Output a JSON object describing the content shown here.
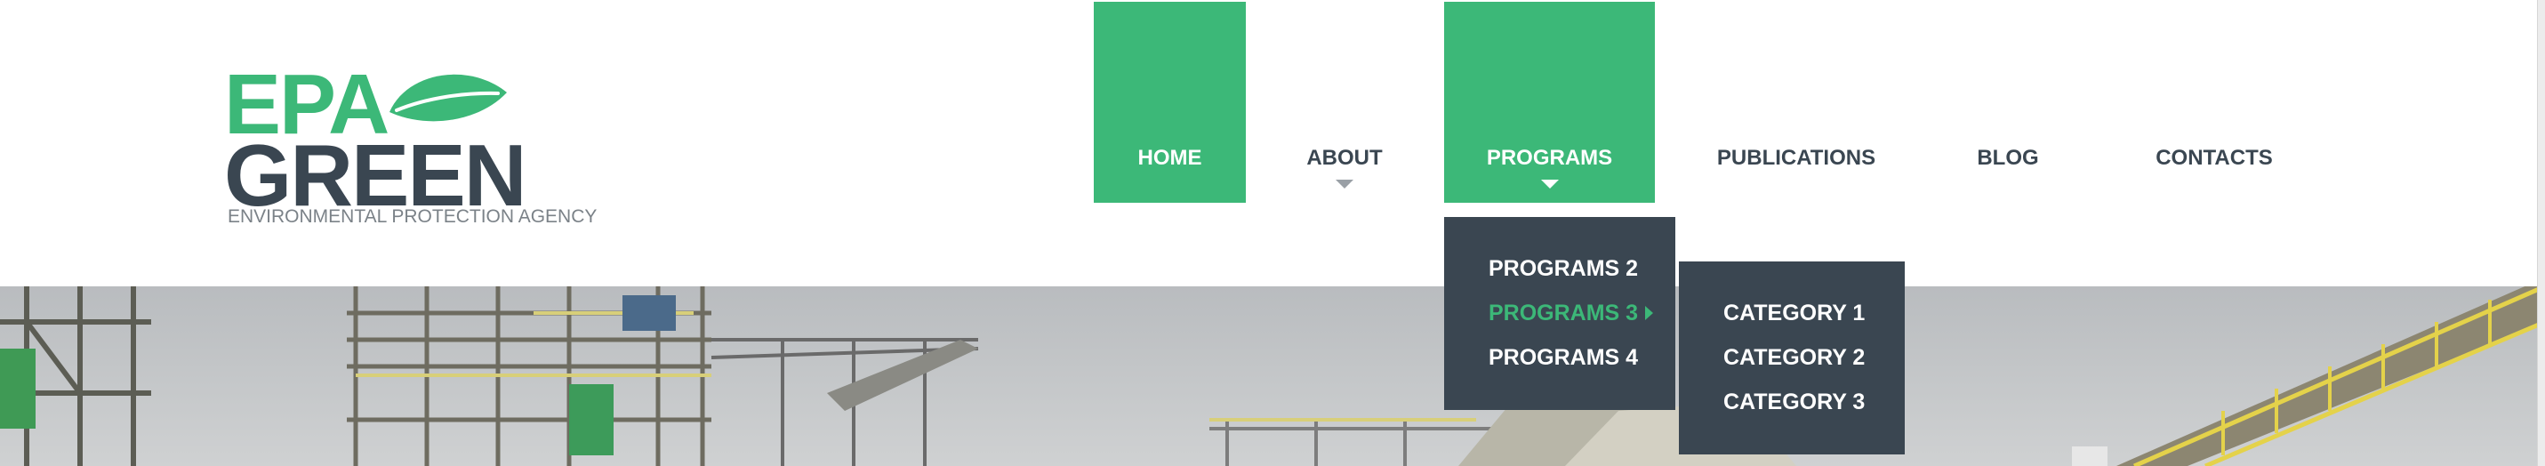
{
  "logo": {
    "line1": "EPA",
    "line2": "GREEN",
    "tagline": "ENVIRONMENTAL PROTECTION AGENCY"
  },
  "nav": {
    "items": [
      {
        "label": "HOME",
        "active": true,
        "has_submenu": false
      },
      {
        "label": "ABOUT",
        "active": false,
        "has_submenu": true
      },
      {
        "label": "PROGRAMS",
        "active": true,
        "has_submenu": true
      },
      {
        "label": "PUBLICATIONS",
        "active": false,
        "has_submenu": false
      },
      {
        "label": "BLOG",
        "active": false,
        "has_submenu": false
      },
      {
        "label": "CONTACTS",
        "active": false,
        "has_submenu": false
      }
    ]
  },
  "programs_menu": {
    "items": [
      {
        "label": "PROGRAMS 2"
      },
      {
        "label": "PROGRAMS 3",
        "highlighted": true,
        "has_submenu": true
      },
      {
        "label": "PROGRAMS 4"
      }
    ]
  },
  "category_menu": {
    "items": [
      {
        "label": "CATEGORY 1"
      },
      {
        "label": "CATEGORY 2"
      },
      {
        "label": "CATEGORY 3"
      }
    ]
  },
  "colors": {
    "brand_green": "#3cb878",
    "dark_slate": "#3a4651",
    "white": "#ffffff"
  },
  "icons": {
    "logo": "leaf-icon",
    "submenu_indicator": "caret-down-icon",
    "flyout_indicator": "caret-right-icon"
  }
}
